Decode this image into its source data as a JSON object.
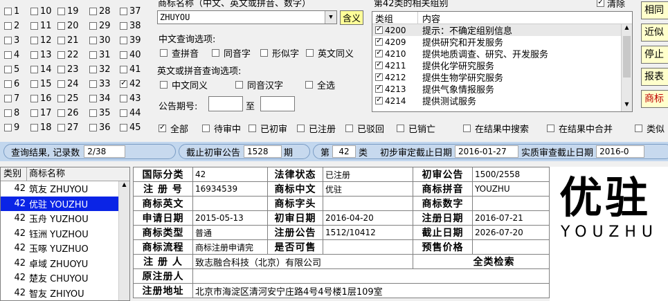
{
  "classes": [
    {
      "n": "1",
      "c": false
    },
    {
      "n": "10",
      "c": false
    },
    {
      "n": "19",
      "c": false
    },
    {
      "n": "28",
      "c": false
    },
    {
      "n": "37",
      "c": false
    },
    {
      "n": "2",
      "c": false
    },
    {
      "n": "11",
      "c": false
    },
    {
      "n": "20",
      "c": false
    },
    {
      "n": "29",
      "c": false
    },
    {
      "n": "38",
      "c": false
    },
    {
      "n": "3",
      "c": false
    },
    {
      "n": "12",
      "c": false
    },
    {
      "n": "21",
      "c": false
    },
    {
      "n": "30",
      "c": false
    },
    {
      "n": "39",
      "c": false
    },
    {
      "n": "4",
      "c": false
    },
    {
      "n": "13",
      "c": false
    },
    {
      "n": "22",
      "c": false
    },
    {
      "n": "31",
      "c": false
    },
    {
      "n": "40",
      "c": false
    },
    {
      "n": "5",
      "c": false
    },
    {
      "n": "14",
      "c": false
    },
    {
      "n": "23",
      "c": false
    },
    {
      "n": "32",
      "c": false
    },
    {
      "n": "41",
      "c": false
    },
    {
      "n": "6",
      "c": false
    },
    {
      "n": "15",
      "c": false
    },
    {
      "n": "24",
      "c": false
    },
    {
      "n": "33",
      "c": false
    },
    {
      "n": "42",
      "c": true
    },
    {
      "n": "7",
      "c": false
    },
    {
      "n": "16",
      "c": false
    },
    {
      "n": "25",
      "c": false
    },
    {
      "n": "34",
      "c": false
    },
    {
      "n": "43",
      "c": false
    },
    {
      "n": "8",
      "c": false
    },
    {
      "n": "17",
      "c": false
    },
    {
      "n": "26",
      "c": false
    },
    {
      "n": "35",
      "c": false
    },
    {
      "n": "44",
      "c": false
    },
    {
      "n": "9",
      "c": false
    },
    {
      "n": "18",
      "c": false
    },
    {
      "n": "27",
      "c": false
    },
    {
      "n": "36",
      "c": false
    },
    {
      "n": "45",
      "c": false
    }
  ],
  "query": {
    "title": "商标名称（中文、英文或拼音、数字）",
    "value": "ZHUYOU",
    "meaning_btn": "含义",
    "cn_options_label": "中文查询选项:",
    "cn_options": [
      "查拼音",
      "同音字",
      "形似字",
      "英文同义"
    ],
    "en_options_label": "英文或拼音查询选项:",
    "en_options": [
      "中文同义",
      "同音汉字",
      "全选"
    ],
    "period_label": "公告期号:",
    "period_to": "至",
    "period_from_val": "",
    "period_to_val": ""
  },
  "groups": {
    "title": "第42类的相关组别",
    "clear_label": "清除",
    "col_group": "类组",
    "col_content": "内容",
    "rows": [
      {
        "code": "4200",
        "text": "提示：不确定组别信息"
      },
      {
        "code": "4209",
        "text": "提供研究和开发服务"
      },
      {
        "code": "4210",
        "text": "提供地质调查、研究、开发服务"
      },
      {
        "code": "4211",
        "text": "提供化学研究服务"
      },
      {
        "code": "4212",
        "text": "提供生物学研究服务"
      },
      {
        "code": "4213",
        "text": "提供气象情报服务"
      },
      {
        "code": "4214",
        "text": "提供测试服务"
      }
    ]
  },
  "side_buttons": [
    "相同",
    "近似",
    "停止",
    "报表",
    "商标"
  ],
  "filters": [
    "全部",
    "待审中",
    "已初审",
    "已注册",
    "已驳回",
    "已销亡",
    "在结果中搜索",
    "在结果中合并",
    "类似"
  ],
  "status": {
    "result_label": "查询结果, 记录数",
    "result_value": "2/38",
    "deadline_label": "截止初审公告",
    "deadline_value": "1528",
    "deadline_unit": "期",
    "class_prefix": "第",
    "class_value": "42",
    "class_unit": "类",
    "prelim_label": "初步审定截止日期",
    "prelim_value": "2016-01-27",
    "substantive_label": "实质审查截止日期",
    "substantive_value": "2016-0"
  },
  "list": {
    "col_class": "类别",
    "col_name": "商标名称",
    "rows": [
      {
        "cls": "42",
        "name": "筑友 ZHUYOU"
      },
      {
        "cls": "42",
        "name": "优驻 YOUZHU"
      },
      {
        "cls": "42",
        "name": "玉舟 YUZHOU"
      },
      {
        "cls": "42",
        "name": "钰洲 YUZHOU"
      },
      {
        "cls": "42",
        "name": "玉啄 YUZHUO"
      },
      {
        "cls": "42",
        "name": "卓域 ZHUOYU"
      },
      {
        "cls": "42",
        "name": "楚友 CHUYOU"
      },
      {
        "cls": "42",
        "name": "智友 ZHIYOU"
      }
    ]
  },
  "detail": {
    "intl_class_l": "国际分类",
    "intl_class_v": "42",
    "legal_status_l": "法律状态",
    "legal_status_v": "已注册",
    "prelim_pub_l": "初审公告",
    "prelim_pub_v": "1500/2558",
    "reg_no_l": "注 册 号",
    "reg_no_v": "16934539",
    "cn_name_l": "商标中文",
    "cn_name_v": "优驻",
    "pinyin_l": "商标拼音",
    "pinyin_v": "YOUZHU",
    "en_name_l": "商标英文",
    "en_name_v": "",
    "initial_l": "商标字头",
    "initial_v": "",
    "digits_l": "商标数字",
    "digits_v": "",
    "apply_date_l": "申请日期",
    "apply_date_v": "2015-05-13",
    "prelim_date_l": "初审日期",
    "prelim_date_v": "2016-04-20",
    "reg_date_l": "注册日期",
    "reg_date_v": "2016-07-21",
    "type_l": "商标类型",
    "type_v": "普通",
    "reg_pub_l": "注册公告",
    "reg_pub_v": "1512/10412",
    "expiry_l": "截止日期",
    "expiry_v": "2026-07-20",
    "process_l": "商标流程",
    "process_v": "商标注册申请完",
    "resale_l": "是否可售",
    "resale_v": "",
    "price_l": "预售价格",
    "price_v": "",
    "registrant_l": "注 册 人",
    "registrant_v": "致志融合科技（北京）有限公司",
    "all_search": "全类检索",
    "orig_registrant_l": "原注册人",
    "orig_registrant_v": "",
    "address_l": "注册地址",
    "address_v": "北京市海淀区清河安宁庄路4号4号楼1层109室"
  },
  "logo": {
    "cn": "优驻",
    "en": "YOUZHU"
  }
}
